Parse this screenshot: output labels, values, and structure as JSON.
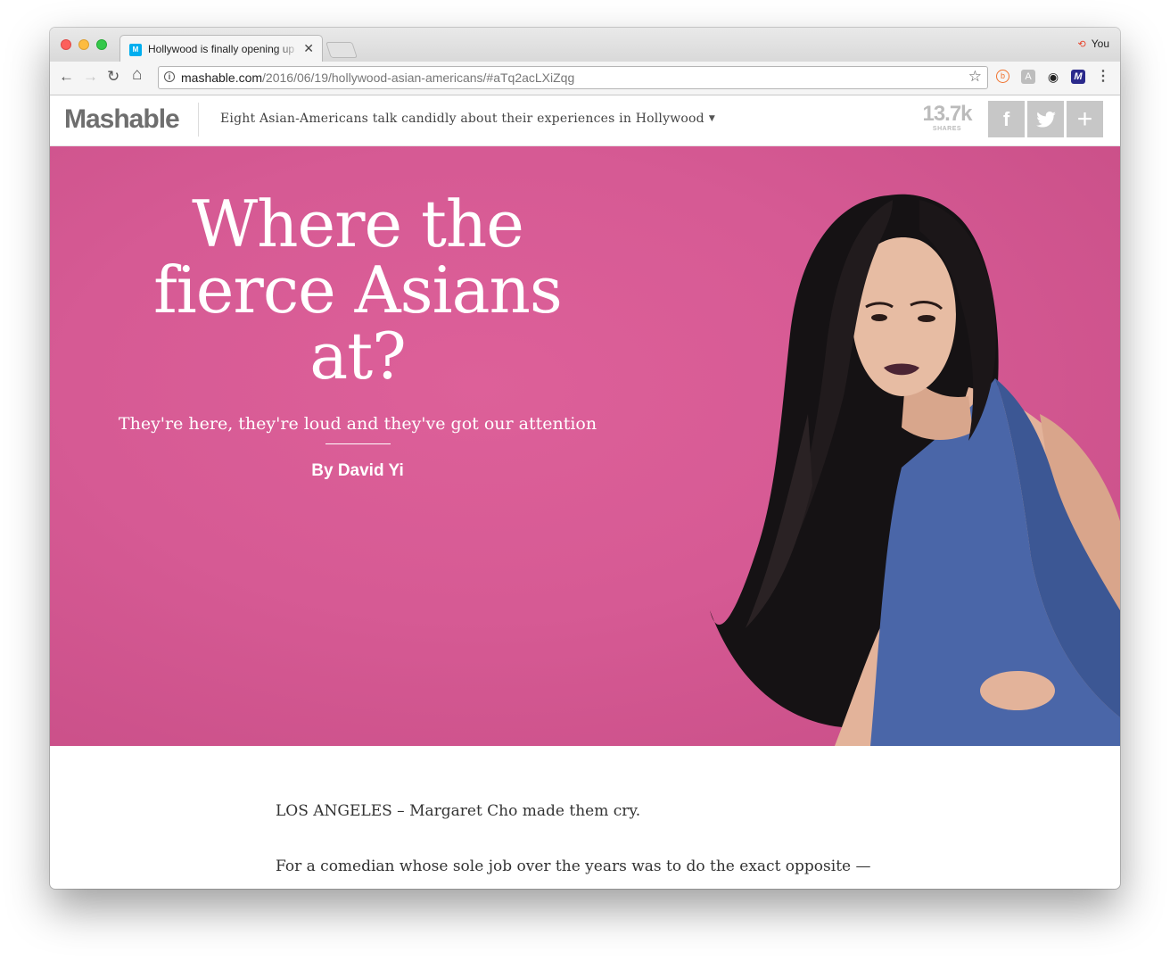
{
  "browser": {
    "tab_title": "Hollywood is finally opening up",
    "tab_favicon_letter": "M",
    "profile_name": "You",
    "url_host": "mashable.com",
    "url_path": "/2016/06/19/hollywood-asian-americans/#aTq2acLXiZqg"
  },
  "site": {
    "logo": "Mashable",
    "headline_nav": "Eight Asian-Americans talk candidly about their experiences in Hollywood",
    "shares_count": "13.7k",
    "shares_label": "SHARES",
    "facebook_label": "f",
    "plus_label": "+"
  },
  "hero": {
    "title_line1": "Where the",
    "title_line2": "fierce Asians",
    "title_line3": "at?",
    "dek": "They're here, they're loud and they've got our attention",
    "byline": "By David Yi",
    "background_color": "#d65a94"
  },
  "article": {
    "para1": "LOS ANGELES – Margaret Cho made them cry.",
    "para2": "For a comedian whose sole job over the years was to do the exact opposite —"
  }
}
